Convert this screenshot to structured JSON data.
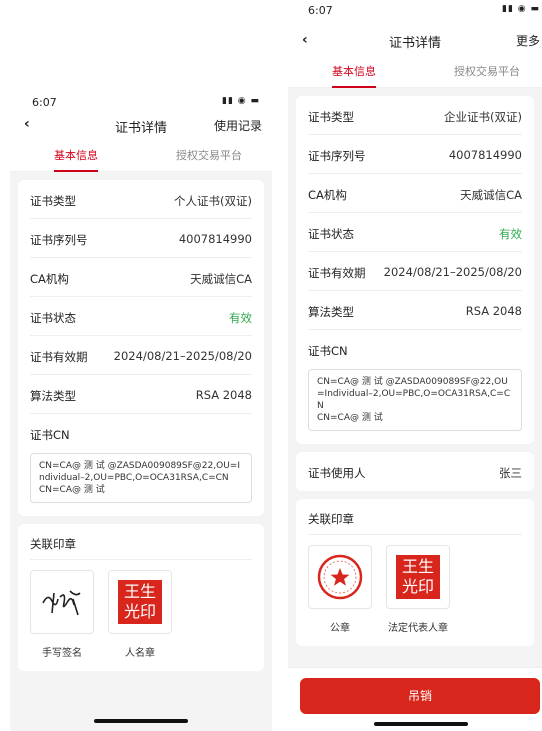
{
  "left": {
    "status_time": "6:07",
    "status_icons": "▮▮ ◉ ▬",
    "back": "‹",
    "title": "证书详情",
    "action": "使用记录",
    "tabs": [
      "基本信息",
      "授权交易平台"
    ],
    "rows": [
      {
        "label": "证书类型",
        "value": "个人证书(双证)"
      },
      {
        "label": "证书序列号",
        "value": "4007814990"
      },
      {
        "label": "CA机构",
        "value": "天威诚信CA"
      },
      {
        "label": "证书状态",
        "value": "有效"
      },
      {
        "label": "证书有效期",
        "value": "2024/08/21–2025/08/20"
      },
      {
        "label": "算法类型",
        "value": "RSA 2048"
      }
    ],
    "cn_label": "证书CN",
    "cn_value": "CN=CA@ 测 试 @ZASDA009089SF@22,OU=Individual–2,OU=PBC,O=OCA31RSA,C=CN\nCN=CA@ 测 试",
    "seal_section": "关联印章",
    "seals": [
      {
        "caption": "手写签名",
        "icon": "handwritten-signature-image"
      },
      {
        "caption": "人名章",
        "icon": "name-seal-image",
        "seal_text": "王生光印"
      }
    ]
  },
  "right": {
    "status_time": "6:07",
    "status_icons": "▮▮ ◉ ▬",
    "back": "‹",
    "title": "证书详情",
    "action": "更多",
    "tabs": [
      "基本信息",
      "授权交易平台"
    ],
    "rows": [
      {
        "label": "证书类型",
        "value": "企业证书(双证)"
      },
      {
        "label": "证书序列号",
        "value": "4007814990"
      },
      {
        "label": "CA机构",
        "value": "天威诚信CA"
      },
      {
        "label": "证书状态",
        "value": "有效"
      },
      {
        "label": "证书有效期",
        "value": "2024/08/21–2025/08/20"
      },
      {
        "label": "算法类型",
        "value": "RSA 2048"
      }
    ],
    "cn_label": "证书CN",
    "cn_value": "CN=CA@ 测 试 @ZASDA009089SF@22,OU=Individual–2,OU=PBC,O=OCA31RSA,C=CN\nCN=CA@ 测 试",
    "user_label": "证书使用人",
    "user_value": "张三",
    "seal_section": "关联印章",
    "seals": [
      {
        "caption": "公章",
        "icon": "official-seal-image"
      },
      {
        "caption": "法定代表人章",
        "icon": "legal-rep-seal-image",
        "seal_text": "王生光印"
      }
    ],
    "revoke_label": "吊销"
  },
  "colors": {
    "accent": "#d0021b",
    "valid": "#2fa84f",
    "button": "#d9261c",
    "background": "#f4f4f4"
  }
}
